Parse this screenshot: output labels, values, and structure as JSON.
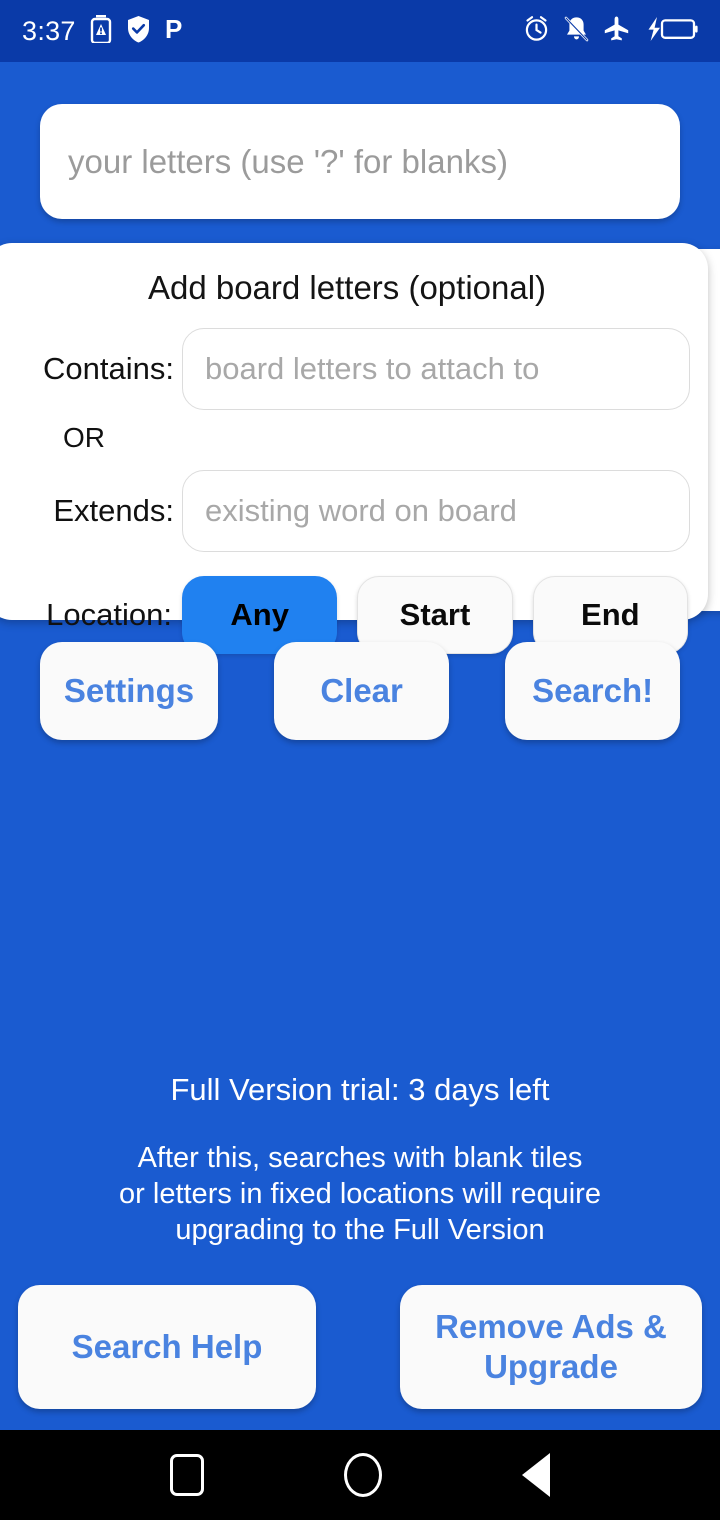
{
  "status_bar": {
    "clock": "3:37",
    "left_icons": [
      "battery-saver-icon",
      "shield-check-icon",
      "letter-p-icon"
    ],
    "right_icons": [
      "alarm-clock-icon",
      "notifications-muted-icon",
      "airplane-mode-icon",
      "battery-charging-icon"
    ],
    "background_color": "#0a3aa8"
  },
  "main": {
    "background_color": "#1a5bd0",
    "letters_input": {
      "placeholder": "your letters (use '?' for blanks)",
      "value": ""
    },
    "board_card": {
      "title": "Add board letters (optional)",
      "contains": {
        "label": "Contains:",
        "placeholder": "board letters to attach to",
        "value": ""
      },
      "or_label": "OR",
      "extends": {
        "label": "Extends:",
        "placeholder": "existing word on board",
        "value": ""
      },
      "location": {
        "label": "Location:",
        "options": [
          "Any",
          "Start",
          "End"
        ],
        "selected": "Any",
        "selected_color": "#2081f0"
      }
    },
    "actions": {
      "settings_label": "Settings",
      "clear_label": "Clear",
      "search_label": "Search!",
      "text_color": "#4a83e0"
    },
    "trial": {
      "headline": "Full Version trial: 3 days left",
      "detail_line_1": "After this, searches with blank tiles",
      "detail_line_2": "or letters in fixed locations will require",
      "detail_line_3": "upgrading to the Full Version"
    },
    "bottom": {
      "search_help_label": "Search Help",
      "remove_ads_line_1": "Remove Ads &",
      "remove_ads_line_2": "Upgrade"
    }
  },
  "nav_bar": {
    "recents_label": "recents-button",
    "home_label": "home-button",
    "back_label": "back-button",
    "background_color": "#000000"
  }
}
